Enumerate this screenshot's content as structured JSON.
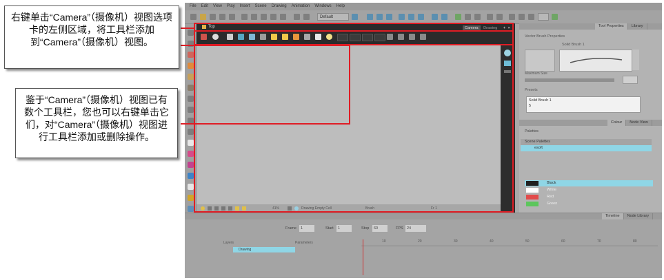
{
  "annotations": {
    "callout_1": "右键单击“Camera”（摄像机）视图选项卡的左侧区域，将工具栏添加到“Camera”（摄像机）视图。",
    "callout_2": "鉴于“Camera”（摄像机）视图已有数个工具栏，您也可以右键单击它们，对“Camera”（摄像机）视图进行工具栏添加或删除操作。"
  },
  "menu": [
    "File",
    "Edit",
    "View",
    "Play",
    "Insert",
    "Scene",
    "Drawing",
    "Animation",
    "Windows",
    "Help"
  ],
  "toolbar": {
    "workspace_value": "Default"
  },
  "camera_view": {
    "tab_labels": [
      "Camera",
      "Drawing"
    ],
    "title": "Top",
    "status": {
      "zoom": "41%",
      "cell": "Drawing Empty Cell",
      "tool": "Brush",
      "frame": "Fr 1"
    }
  },
  "tool_properties": {
    "tabs": [
      "Tool Properties",
      "Library"
    ],
    "section": "Vector Brush Properties",
    "brush_name": "Solid Brush 1",
    "max_size_label": "Maximum Size",
    "presets_label": "Presets",
    "preset_items": [
      "Solid Brush 1",
      "5"
    ]
  },
  "colour": {
    "tabs": [
      "Colour",
      "Node View"
    ],
    "palettes_label": "Palettes",
    "scene_palettes": "Scene Palettes",
    "palette_name": "esoft",
    "colours": [
      {
        "name": "Black",
        "hex": "#202020",
        "selected": true
      },
      {
        "name": "White",
        "hex": "#ffffff",
        "selected": false
      },
      {
        "name": "Red",
        "hex": "#e24b4b",
        "selected": false
      },
      {
        "name": "Green",
        "hex": "#5cc65c",
        "selected": false
      }
    ]
  },
  "timeline": {
    "tabs": [
      "Timeline",
      "Node Library"
    ],
    "frame_label": "Frame",
    "frame_value": "1",
    "start_label": "Start",
    "start_value": "1",
    "stop_label": "Stop",
    "stop_value": "60",
    "fps_label": "FPS",
    "fps_value": "24",
    "layers_label": "Layers",
    "parameters_label": "Parameters",
    "layer_name": "Drawing",
    "ruler": [
      "10",
      "20",
      "30",
      "40",
      "50",
      "60",
      "70",
      "80"
    ]
  },
  "colors": {
    "highlight": "#e01c24",
    "selection": "#8fd6e6"
  }
}
